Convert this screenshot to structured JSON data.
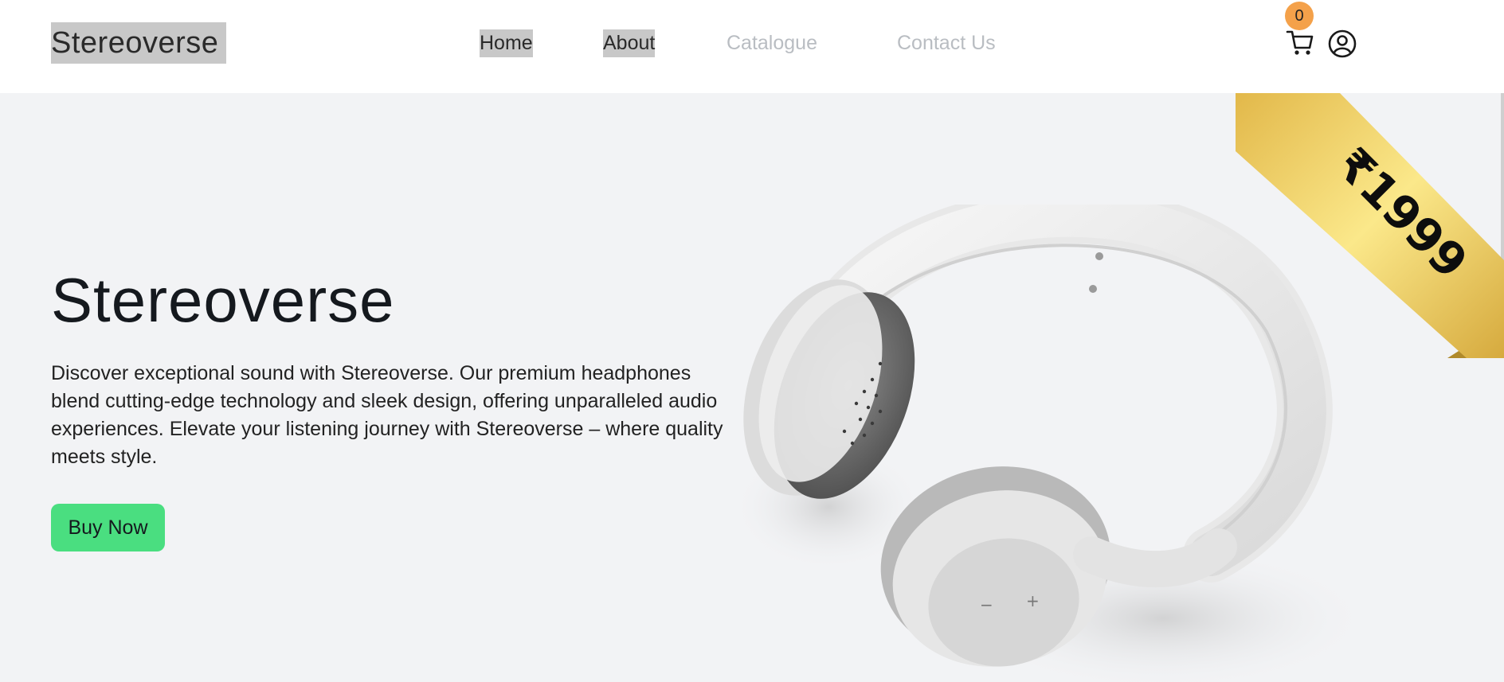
{
  "brand": {
    "logo_text": "Stereoverse"
  },
  "nav": {
    "items": [
      {
        "label": "Home",
        "state": "active"
      },
      {
        "label": "About",
        "state": "active"
      },
      {
        "label": "Catalogue",
        "state": "muted"
      },
      {
        "label": "Contact Us",
        "state": "muted"
      }
    ]
  },
  "header_icons": {
    "cart_icon": "cart-icon",
    "cart_count": "0",
    "user_icon": "user-circle-icon"
  },
  "hero": {
    "title": "Stereoverse",
    "description": "Discover exceptional sound with Stereoverse. Our premium headphones blend cutting-edge technology and sleek design, offering unparalleled audio experiences. Elevate your listening journey with Stereoverse – where quality meets style.",
    "cta_label": "Buy Now",
    "price_ribbon": "₹1999"
  },
  "colors": {
    "accent_green": "#4ade80",
    "badge_orange": "#f4a14a",
    "hero_bg": "#f2f3f5",
    "ribbon_gold": "#e9c75a"
  }
}
